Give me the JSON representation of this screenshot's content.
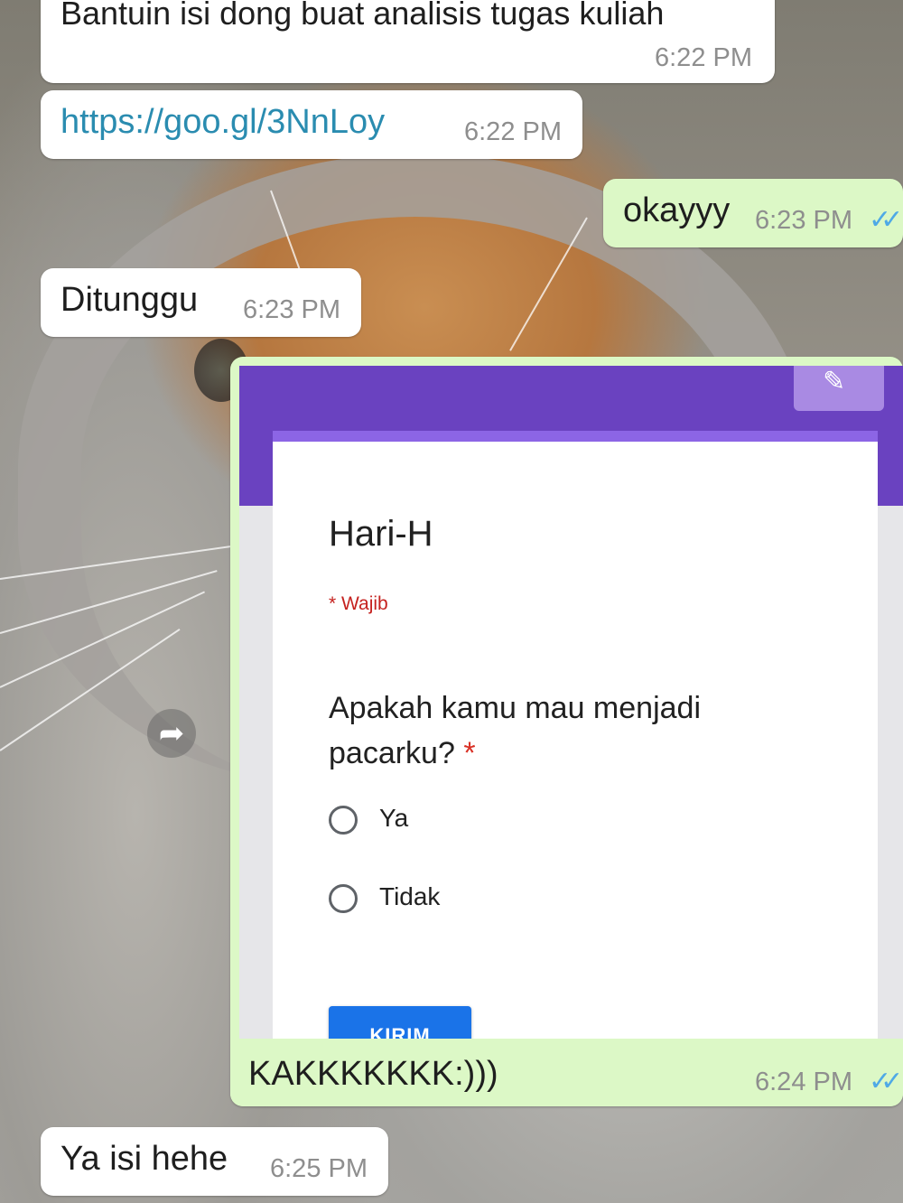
{
  "messages": [
    {
      "text": "Bantuin isi dong buat analisis tugas kuliah",
      "time": "6:22 PM",
      "direction": "incoming"
    },
    {
      "text": "https://goo.gl/3NnLoy",
      "time": "6:22 PM",
      "direction": "incoming"
    },
    {
      "text": "okayyy",
      "time": "6:23 PM",
      "direction": "outgoing",
      "status": "read"
    },
    {
      "text": "Ditunggu",
      "time": "6:23 PM",
      "direction": "incoming"
    },
    {
      "text": "KAKKKKKKK:)))",
      "time": "6:24 PM",
      "direction": "outgoing",
      "status": "read"
    },
    {
      "text": "Ya isi hehe",
      "time": "6:25 PM",
      "direction": "incoming"
    }
  ],
  "form": {
    "title": "Hari-H",
    "required_note": "* Wajib",
    "question": "Apakah kamu mau menjadi pacarku?",
    "required_mark": "*",
    "options": [
      "Ya",
      "Tidak"
    ],
    "submit_label": "KIRIM"
  },
  "icons": {
    "forward": "forward-arrow-icon",
    "read_receipt": "double-check-icon"
  },
  "colors": {
    "incoming_bubble": "#ffffff",
    "outgoing_bubble": "#dcf8c6",
    "read_ticks": "#4fa9e6",
    "form_header": "#6a42c0",
    "submit_button": "#1a73e8"
  }
}
